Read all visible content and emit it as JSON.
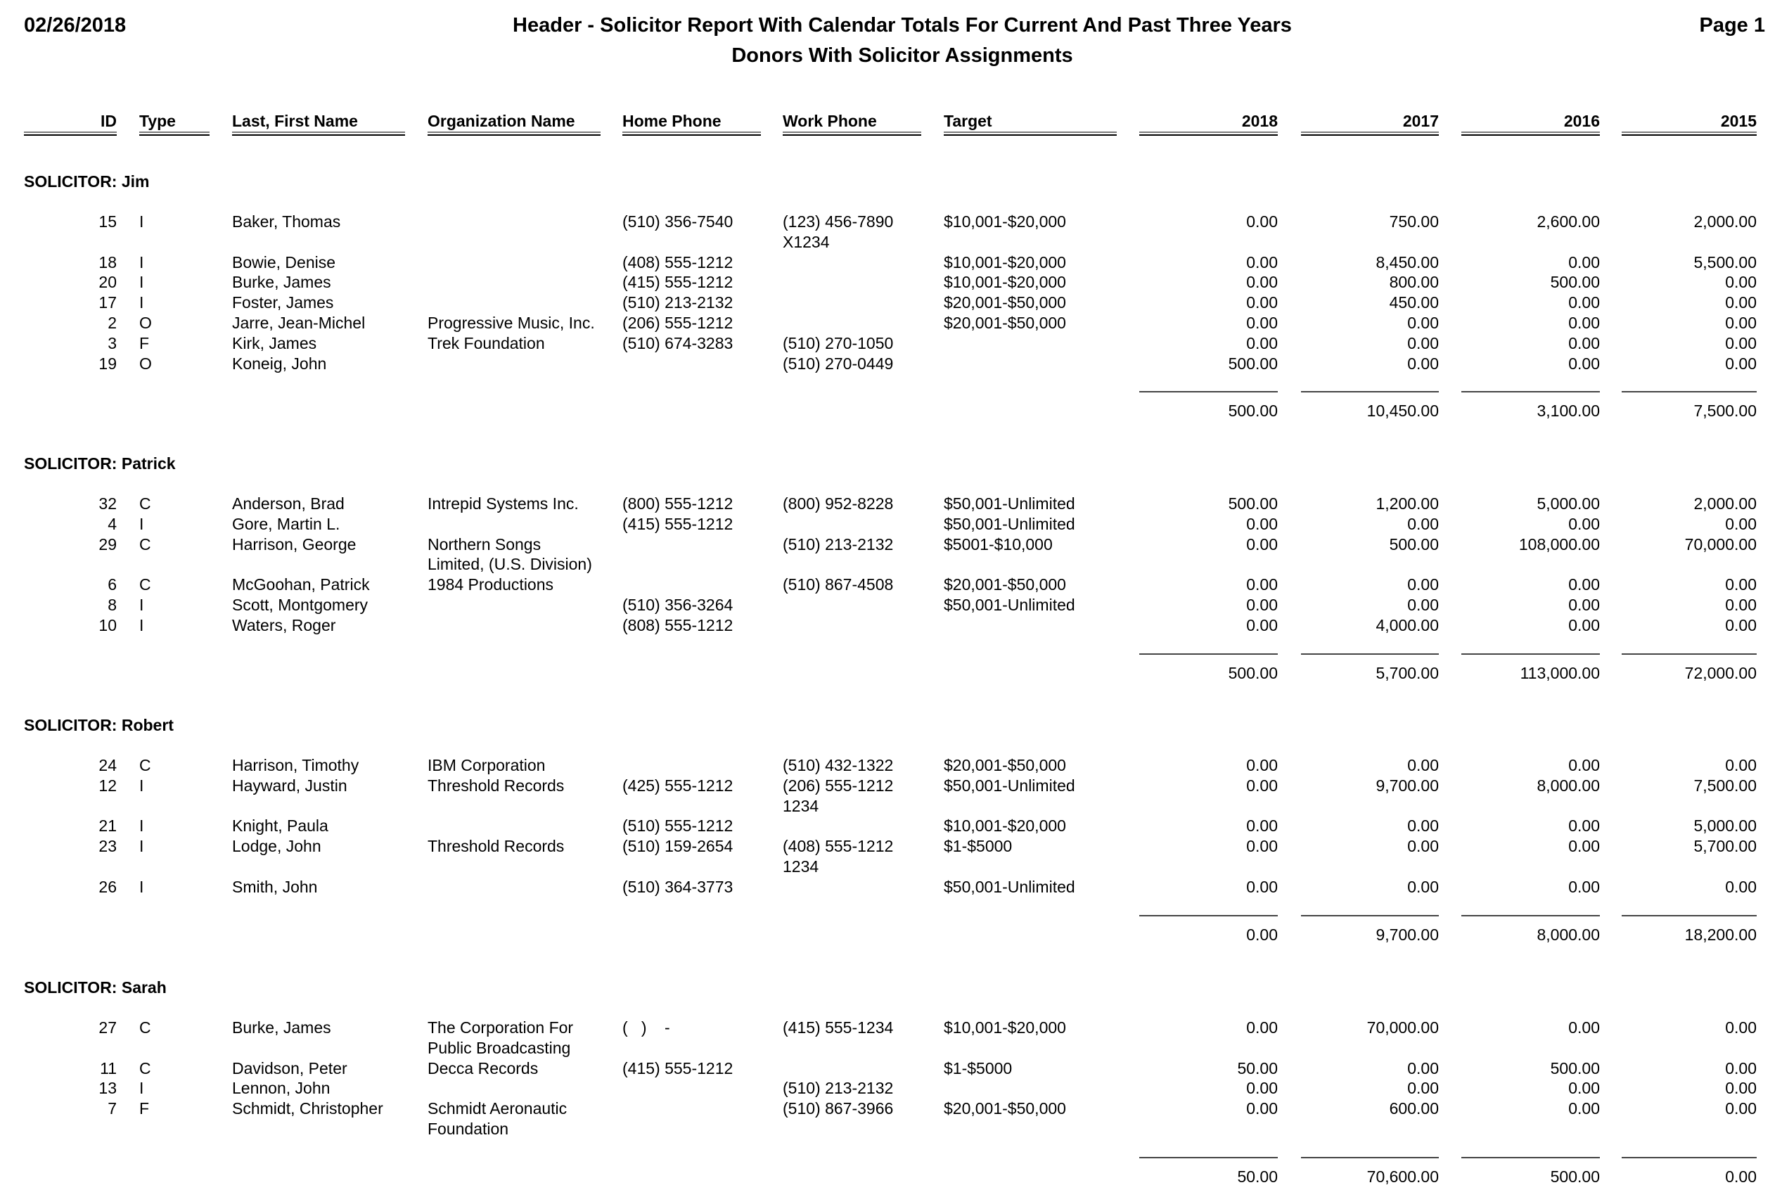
{
  "header": {
    "date": "02/26/2018",
    "title": "Header - Solicitor Report With Calendar Totals For Current And Past Three Years",
    "subtitle": "Donors With Solicitor Assignments",
    "page": "Page 1"
  },
  "columns": {
    "id": "ID",
    "type": "Type",
    "name": "Last, First Name",
    "org": "Organization Name",
    "home": "Home Phone",
    "work": "Work Phone",
    "target": "Target",
    "y2018": "2018",
    "y2017": "2017",
    "y2016": "2016",
    "y2015": "2015"
  },
  "solicitor_prefix": "SOLICITOR:",
  "groups": [
    {
      "solicitor": "Jim",
      "rows": [
        {
          "id": "15",
          "type": "I",
          "name": "Baker, Thomas",
          "org": "",
          "home": "(510) 356-7540",
          "work": "(123) 456-7890\nX1234",
          "target": "$10,001-$20,000",
          "y2018": "0.00",
          "y2017": "750.00",
          "y2016": "2,600.00",
          "y2015": "2,000.00"
        },
        {
          "id": "18",
          "type": "I",
          "name": "Bowie, Denise",
          "org": "",
          "home": "(408) 555-1212",
          "work": "",
          "target": "$10,001-$20,000",
          "y2018": "0.00",
          "y2017": "8,450.00",
          "y2016": "0.00",
          "y2015": "5,500.00"
        },
        {
          "id": "20",
          "type": "I",
          "name": "Burke, James",
          "org": "",
          "home": "(415) 555-1212",
          "work": "",
          "target": "$10,001-$20,000",
          "y2018": "0.00",
          "y2017": "800.00",
          "y2016": "500.00",
          "y2015": "0.00"
        },
        {
          "id": "17",
          "type": "I",
          "name": "Foster, James",
          "org": "",
          "home": "(510) 213-2132",
          "work": "",
          "target": "$20,001-$50,000",
          "y2018": "0.00",
          "y2017": "450.00",
          "y2016": "0.00",
          "y2015": "0.00"
        },
        {
          "id": "2",
          "type": "O",
          "name": "Jarre, Jean-Michel",
          "org": "Progressive Music, Inc.",
          "home": "(206) 555-1212",
          "work": "",
          "target": "$20,001-$50,000",
          "y2018": "0.00",
          "y2017": "0.00",
          "y2016": "0.00",
          "y2015": "0.00"
        },
        {
          "id": "3",
          "type": "F",
          "name": "Kirk, James",
          "org": "Trek Foundation",
          "home": "(510) 674-3283",
          "work": "(510) 270-1050",
          "target": "",
          "y2018": "0.00",
          "y2017": "0.00",
          "y2016": "0.00",
          "y2015": "0.00"
        },
        {
          "id": "19",
          "type": "O",
          "name": "Koneig, John",
          "org": "",
          "home": "",
          "work": "(510) 270-0449",
          "target": "",
          "y2018": "500.00",
          "y2017": "0.00",
          "y2016": "0.00",
          "y2015": "0.00"
        }
      ],
      "totals": {
        "y2018": "500.00",
        "y2017": "10,450.00",
        "y2016": "3,100.00",
        "y2015": "7,500.00"
      }
    },
    {
      "solicitor": "Patrick",
      "rows": [
        {
          "id": "32",
          "type": "C",
          "name": "Anderson, Brad",
          "org": "Intrepid Systems Inc.",
          "home": "(800) 555-1212",
          "work": "(800) 952-8228",
          "target": "$50,001-Unlimited",
          "y2018": "500.00",
          "y2017": "1,200.00",
          "y2016": "5,000.00",
          "y2015": "2,000.00"
        },
        {
          "id": "4",
          "type": "I",
          "name": "Gore, Martin L.",
          "org": "",
          "home": "(415) 555-1212",
          "work": "",
          "target": "$50,001-Unlimited",
          "y2018": "0.00",
          "y2017": "0.00",
          "y2016": "0.00",
          "y2015": "0.00"
        },
        {
          "id": "29",
          "type": "C",
          "name": "Harrison, George",
          "org": "Northern Songs\nLimited, (U.S. Division)",
          "home": "",
          "work": "(510) 213-2132",
          "target": "$5001-$10,000",
          "y2018": "0.00",
          "y2017": "500.00",
          "y2016": "108,000.00",
          "y2015": "70,000.00"
        },
        {
          "id": "6",
          "type": "C",
          "name": "McGoohan, Patrick",
          "org": "1984 Productions",
          "home": "",
          "work": "(510) 867-4508",
          "target": "$20,001-$50,000",
          "y2018": "0.00",
          "y2017": "0.00",
          "y2016": "0.00",
          "y2015": "0.00"
        },
        {
          "id": "8",
          "type": "I",
          "name": "Scott, Montgomery",
          "org": "",
          "home": "(510) 356-3264",
          "work": "",
          "target": "$50,001-Unlimited",
          "y2018": "0.00",
          "y2017": "0.00",
          "y2016": "0.00",
          "y2015": "0.00"
        },
        {
          "id": "10",
          "type": "I",
          "name": "Waters, Roger",
          "org": "",
          "home": "(808) 555-1212",
          "work": "",
          "target": "",
          "y2018": "0.00",
          "y2017": "4,000.00",
          "y2016": "0.00",
          "y2015": "0.00"
        }
      ],
      "totals": {
        "y2018": "500.00",
        "y2017": "5,700.00",
        "y2016": "113,000.00",
        "y2015": "72,000.00"
      }
    },
    {
      "solicitor": "Robert",
      "rows": [
        {
          "id": "24",
          "type": "C",
          "name": "Harrison, Timothy",
          "org": "IBM Corporation",
          "home": "",
          "work": "(510) 432-1322",
          "target": "$20,001-$50,000",
          "y2018": "0.00",
          "y2017": "0.00",
          "y2016": "0.00",
          "y2015": "0.00"
        },
        {
          "id": "12",
          "type": "I",
          "name": "Hayward, Justin",
          "org": "Threshold Records",
          "home": "(425) 555-1212",
          "work": "(206) 555-1212\n1234",
          "target": "$50,001-Unlimited",
          "y2018": "0.00",
          "y2017": "9,700.00",
          "y2016": "8,000.00",
          "y2015": "7,500.00"
        },
        {
          "id": "21",
          "type": "I",
          "name": "Knight, Paula",
          "org": "",
          "home": "(510) 555-1212",
          "work": "",
          "target": "$10,001-$20,000",
          "y2018": "0.00",
          "y2017": "0.00",
          "y2016": "0.00",
          "y2015": "5,000.00"
        },
        {
          "id": "23",
          "type": "I",
          "name": "Lodge, John",
          "org": "Threshold Records",
          "home": "(510) 159-2654",
          "work": "(408) 555-1212\n1234",
          "target": "$1-$5000",
          "y2018": "0.00",
          "y2017": "0.00",
          "y2016": "0.00",
          "y2015": "5,700.00"
        },
        {
          "id": "26",
          "type": "I",
          "name": "Smith, John",
          "org": "",
          "home": "(510) 364-3773",
          "work": "",
          "target": "$50,001-Unlimited",
          "y2018": "0.00",
          "y2017": "0.00",
          "y2016": "0.00",
          "y2015": "0.00"
        }
      ],
      "totals": {
        "y2018": "0.00",
        "y2017": "9,700.00",
        "y2016": "8,000.00",
        "y2015": "18,200.00"
      }
    },
    {
      "solicitor": "Sarah",
      "rows": [
        {
          "id": "27",
          "type": "C",
          "name": "Burke, James",
          "org": "The Corporation For\nPublic Broadcasting",
          "home": "(   )    -",
          "work": "(415) 555-1234",
          "target": "$10,001-$20,000",
          "y2018": "0.00",
          "y2017": "70,000.00",
          "y2016": "0.00",
          "y2015": "0.00"
        },
        {
          "id": "11",
          "type": "C",
          "name": "Davidson, Peter",
          "org": "Decca Records",
          "home": "(415) 555-1212",
          "work": "",
          "target": "$1-$5000",
          "y2018": "50.00",
          "y2017": "0.00",
          "y2016": "500.00",
          "y2015": "0.00"
        },
        {
          "id": "13",
          "type": "I",
          "name": "Lennon, John",
          "org": "",
          "home": "",
          "work": "(510) 213-2132",
          "target": "",
          "y2018": "0.00",
          "y2017": "0.00",
          "y2016": "0.00",
          "y2015": "0.00"
        },
        {
          "id": "7",
          "type": "F",
          "name": "Schmidt, Christopher",
          "org": "Schmidt Aeronautic\nFoundation",
          "home": "",
          "work": "(510) 867-3966",
          "target": "$20,001-$50,000",
          "y2018": "0.00",
          "y2017": "600.00",
          "y2016": "0.00",
          "y2015": "0.00"
        }
      ],
      "totals": {
        "y2018": "50.00",
        "y2017": "70,600.00",
        "y2016": "500.00",
        "y2015": "0.00"
      }
    }
  ]
}
